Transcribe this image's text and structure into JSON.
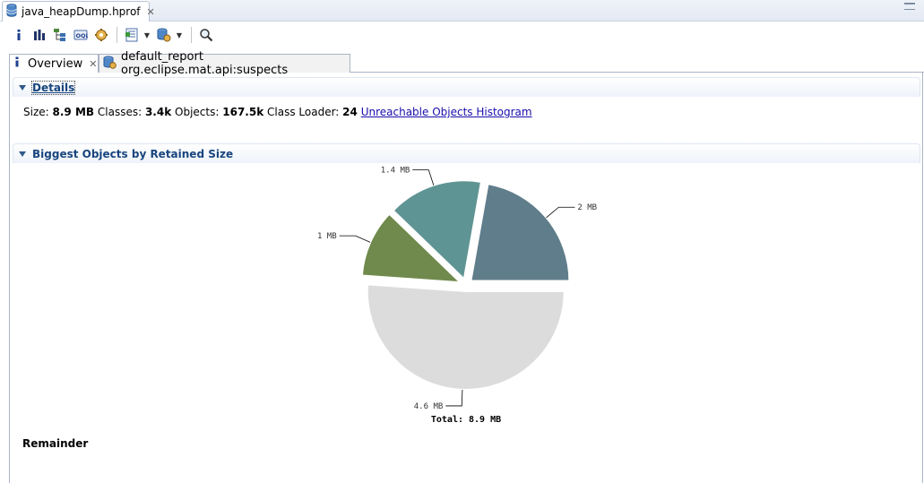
{
  "editor_tab": {
    "label": "java_heapDump.hprof"
  },
  "toolbar": {
    "icons": [
      "info-icon",
      "histogram-icon",
      "dominator-tree-icon",
      "oql-icon",
      "heap-dump-overview-icon",
      "query-browser-icon",
      "run-report-icon",
      "search-icon"
    ]
  },
  "inner_tabs": [
    {
      "label": "Overview"
    },
    {
      "label": "default_report  org.eclipse.mat.api:suspects"
    }
  ],
  "details": {
    "title": "Details",
    "size_label": "Size:",
    "size_value": "8.9 MB",
    "classes_label": "Classes:",
    "classes_value": "3.4k",
    "objects_label": "Objects:",
    "objects_value": "167.5k",
    "loader_label": "Class Loader:",
    "loader_value": "24",
    "link": "Unreachable Objects Histogram"
  },
  "biggest": {
    "title": "Biggest Objects by Retained Size"
  },
  "chart_data": {
    "type": "pie",
    "total_label": "Total: 8.9 MB",
    "slices": [
      {
        "label": "2 MB",
        "value": 2.0,
        "color": "#607d8b"
      },
      {
        "label": "1.4 MB",
        "value": 1.4,
        "color": "#5f9494"
      },
      {
        "label": "1 MB",
        "value": 1.0,
        "color": "#6f8a4c"
      },
      {
        "label": "4.6 MB",
        "value": 4.6,
        "color": "#dcdcdc"
      }
    ]
  },
  "remainder": {
    "label": "Remainder"
  }
}
